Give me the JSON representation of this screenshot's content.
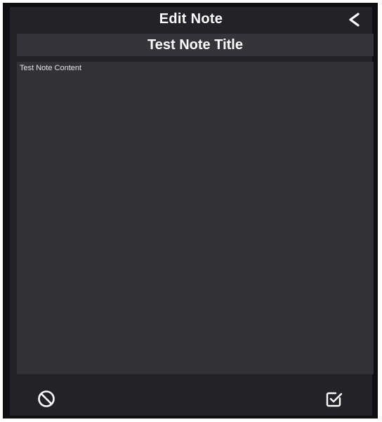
{
  "header": {
    "title": "Edit Note"
  },
  "note": {
    "title": "Test Note Title",
    "content": "Test Note Content"
  },
  "icons": {
    "back": "chevron-left-icon",
    "cancel": "no-entry-icon",
    "save": "checkbox-check-icon"
  },
  "colors": {
    "background": "#232327",
    "field": "#313136",
    "text": "#ffffff"
  }
}
